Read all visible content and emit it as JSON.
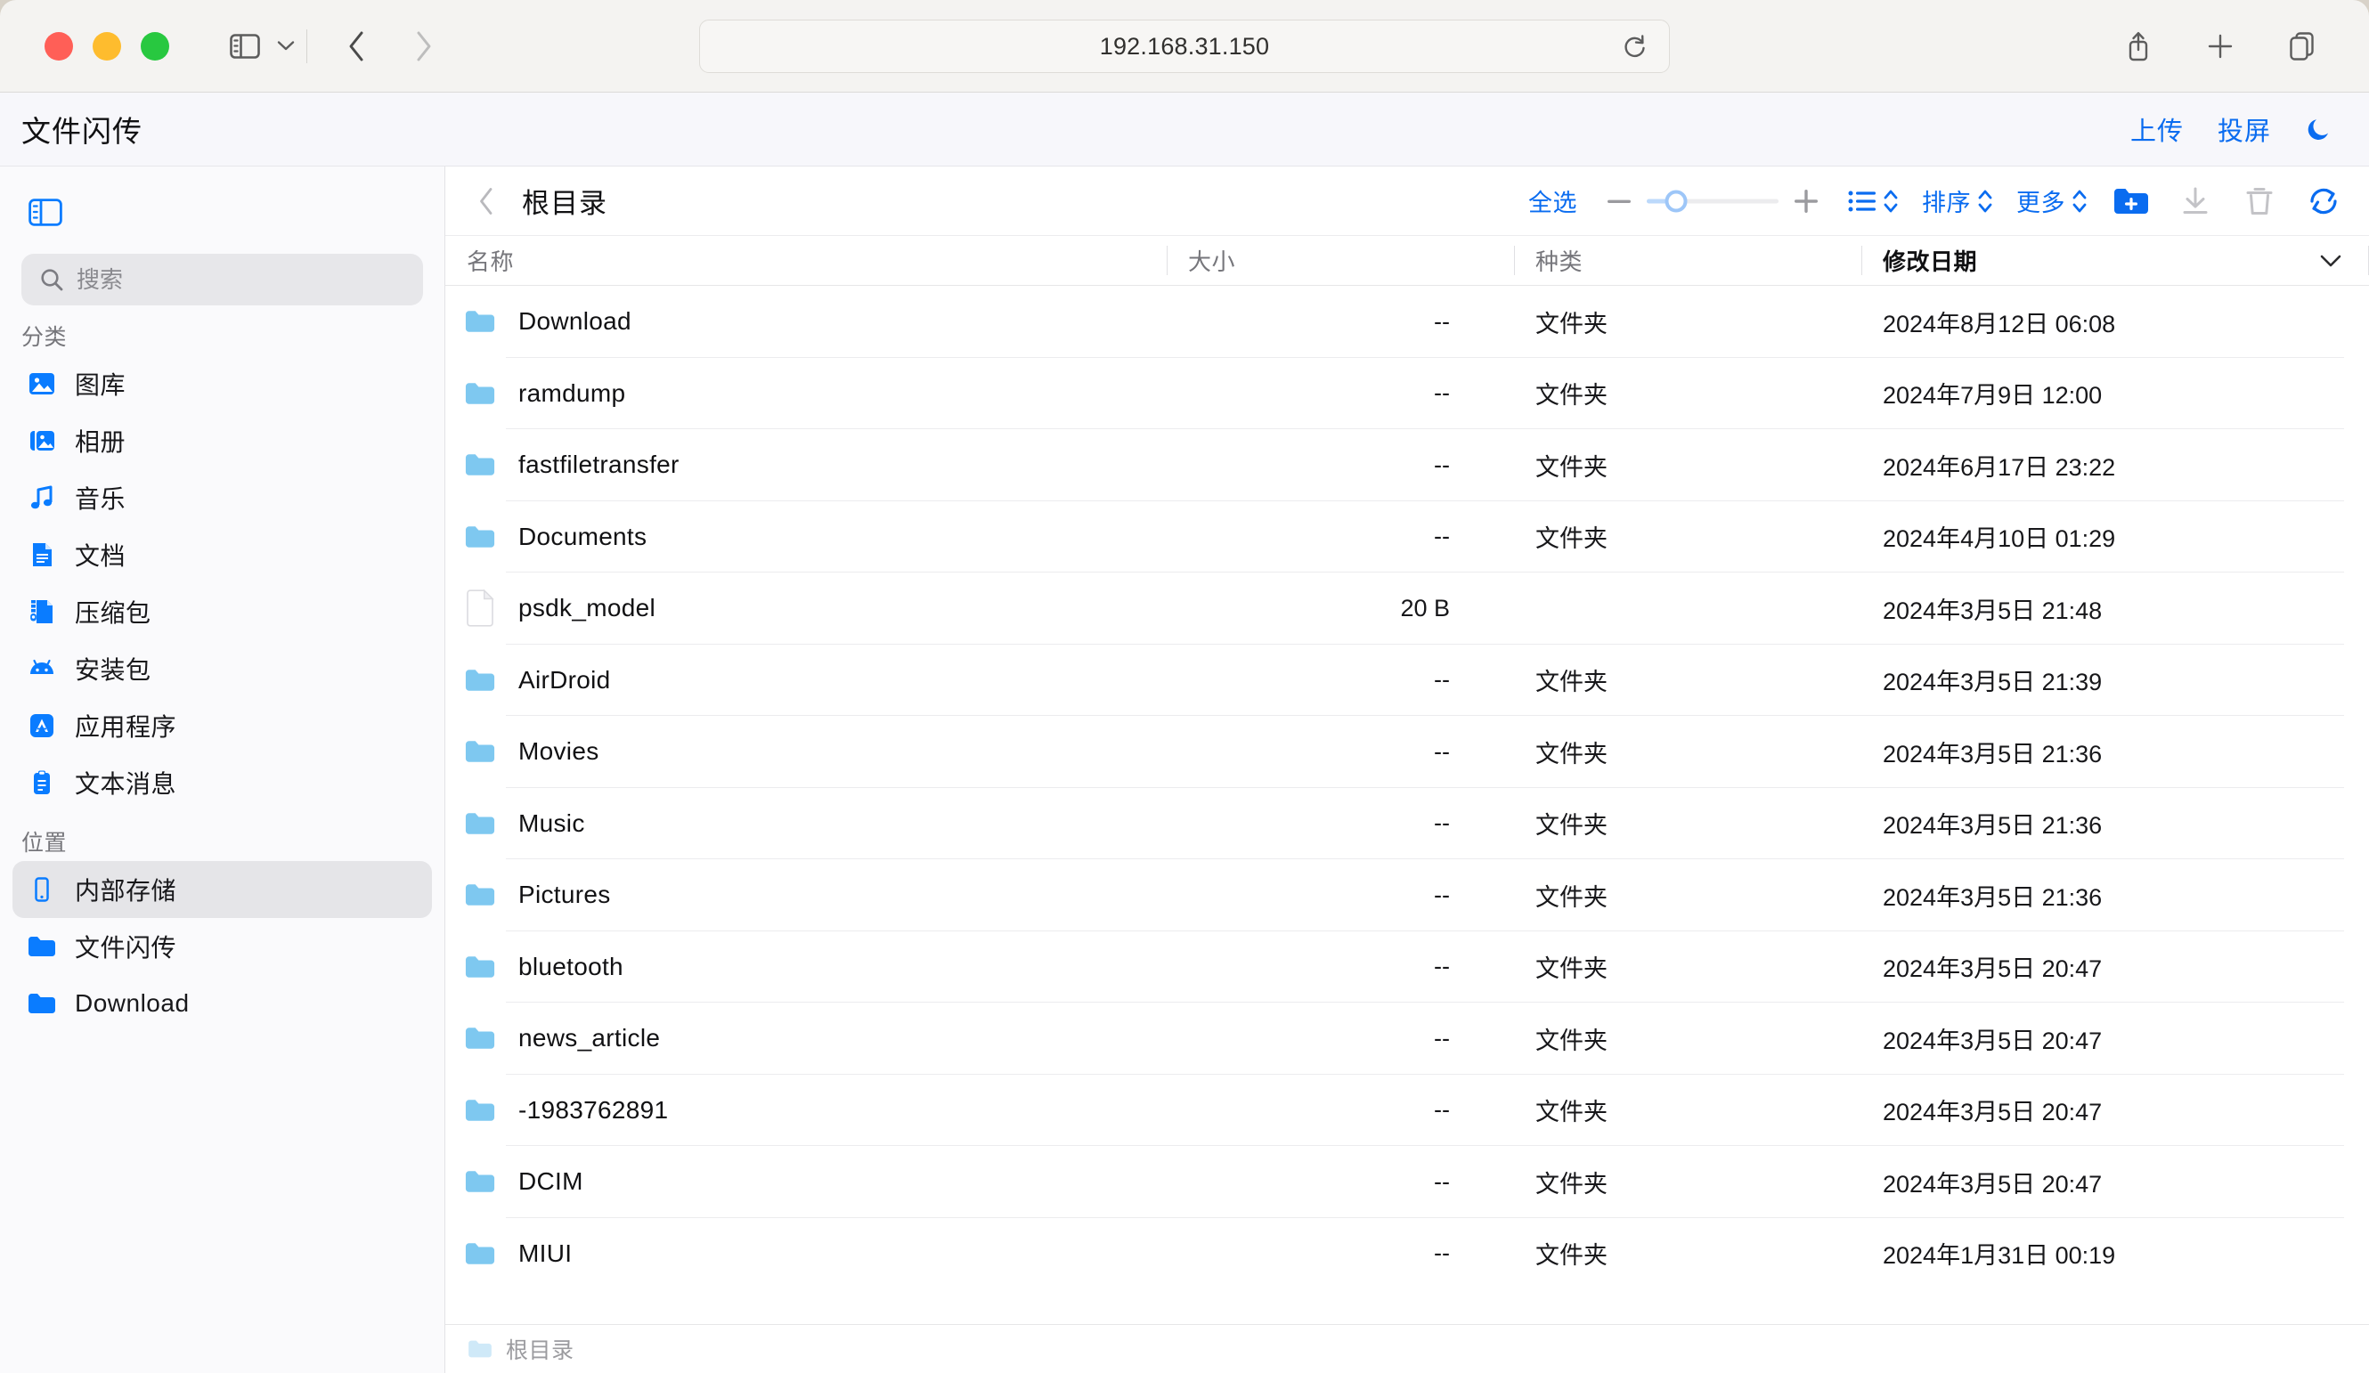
{
  "browser": {
    "url": "192.168.31.150",
    "traffic_lights": [
      "close",
      "minimize",
      "zoom"
    ],
    "buttons": {
      "sidebar_toggle": "sidebar-toggle",
      "tab_overview_chevron": "chevron-down",
      "back": "back",
      "forward": "forward",
      "reload": "reload",
      "share": "share",
      "new_tab": "new-tab",
      "tabs": "tab-overview"
    }
  },
  "app": {
    "title": "文件闪传",
    "actions": {
      "upload": "上传",
      "cast": "投屏",
      "theme_icon": "moon-icon"
    }
  },
  "sidebar": {
    "search": {
      "value": "",
      "placeholder": "搜索"
    },
    "sections": [
      {
        "title": "分类",
        "items": [
          {
            "label": "图库",
            "icon": "photo-icon",
            "selected": false
          },
          {
            "label": "相册",
            "icon": "photo-stack-icon",
            "selected": false
          },
          {
            "label": "音乐",
            "icon": "music-note-icon",
            "selected": false
          },
          {
            "label": "文档",
            "icon": "document-icon",
            "selected": false
          },
          {
            "label": "压缩包",
            "icon": "zip-icon",
            "selected": false
          },
          {
            "label": "安装包",
            "icon": "android-icon",
            "selected": false
          },
          {
            "label": "应用程序",
            "icon": "appstore-icon",
            "selected": false
          },
          {
            "label": "文本消息",
            "icon": "clipboard-icon",
            "selected": false
          }
        ]
      },
      {
        "title": "位置",
        "items": [
          {
            "label": "内部存储",
            "icon": "phone-icon",
            "selected": true
          },
          {
            "label": "文件闪传",
            "icon": "folder-icon",
            "selected": false
          },
          {
            "label": "Download",
            "icon": "folder-icon",
            "selected": false
          }
        ]
      }
    ]
  },
  "toolbar": {
    "breadcrumb": "根目录",
    "select_all": "全选",
    "zoom": {
      "minus": "−",
      "plus": "+",
      "value_percent": 22
    },
    "view_mode": "list-view",
    "sort": "排序",
    "more": "更多",
    "new_folder": "new-folder-icon",
    "download": "download-icon",
    "delete": "trash-icon",
    "refresh": "refresh-icon"
  },
  "table": {
    "columns": [
      {
        "key": "name",
        "label": "名称",
        "active": false
      },
      {
        "key": "size",
        "label": "大小",
        "active": false
      },
      {
        "key": "kind",
        "label": "种类",
        "active": false
      },
      {
        "key": "date",
        "label": "修改日期",
        "active": true,
        "sort_direction": "desc"
      }
    ],
    "rows": [
      {
        "name": "Download",
        "size": "--",
        "kind": "文件夹",
        "date": "2024年8月12日 06:08",
        "icon": "folder-icon"
      },
      {
        "name": "ramdump",
        "size": "--",
        "kind": "文件夹",
        "date": "2024年7月9日 12:00",
        "icon": "folder-icon"
      },
      {
        "name": "fastfiletransfer",
        "size": "--",
        "kind": "文件夹",
        "date": "2024年6月17日 23:22",
        "icon": "folder-icon"
      },
      {
        "name": "Documents",
        "size": "--",
        "kind": "文件夹",
        "date": "2024年4月10日 01:29",
        "icon": "folder-icon"
      },
      {
        "name": "psdk_model",
        "size": "20 B",
        "kind": "",
        "date": "2024年3月5日 21:48",
        "icon": "file-icon"
      },
      {
        "name": "AirDroid",
        "size": "--",
        "kind": "文件夹",
        "date": "2024年3月5日 21:39",
        "icon": "folder-icon"
      },
      {
        "name": "Movies",
        "size": "--",
        "kind": "文件夹",
        "date": "2024年3月5日 21:36",
        "icon": "folder-icon"
      },
      {
        "name": "Music",
        "size": "--",
        "kind": "文件夹",
        "date": "2024年3月5日 21:36",
        "icon": "folder-icon"
      },
      {
        "name": "Pictures",
        "size": "--",
        "kind": "文件夹",
        "date": "2024年3月5日 21:36",
        "icon": "folder-icon"
      },
      {
        "name": "bluetooth",
        "size": "--",
        "kind": "文件夹",
        "date": "2024年3月5日 20:47",
        "icon": "folder-icon"
      },
      {
        "name": "news_article",
        "size": "--",
        "kind": "文件夹",
        "date": "2024年3月5日 20:47",
        "icon": "folder-icon"
      },
      {
        "name": "-1983762891",
        "size": "--",
        "kind": "文件夹",
        "date": "2024年3月5日 20:47",
        "icon": "folder-icon"
      },
      {
        "name": "DCIM",
        "size": "--",
        "kind": "文件夹",
        "date": "2024年3月5日 20:47",
        "icon": "folder-icon"
      },
      {
        "name": "MIUI",
        "size": "--",
        "kind": "文件夹",
        "date": "2024年1月31日 00:19",
        "icon": "folder-icon"
      }
    ]
  },
  "status_bar": {
    "path": "根目录",
    "icon": "folder-icon"
  },
  "colors": {
    "accent_blue": "#0a6cf0",
    "icon_blue": "#0a7cff",
    "folder_blue": "#7ec8f0",
    "app_header_bg": "#f7f7fb",
    "sidebar_bg": "#fafafc"
  }
}
